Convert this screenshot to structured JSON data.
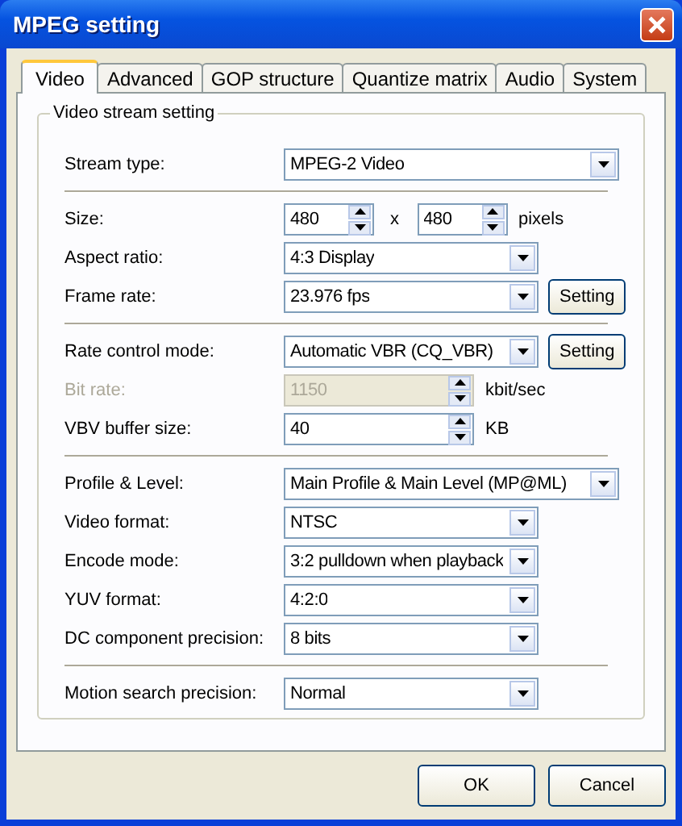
{
  "window": {
    "title": "MPEG setting"
  },
  "tabs": [
    {
      "label": "Video",
      "selected": true
    },
    {
      "label": "Advanced",
      "selected": false
    },
    {
      "label": "GOP structure",
      "selected": false
    },
    {
      "label": "Quantize matrix",
      "selected": false
    },
    {
      "label": "Audio",
      "selected": false
    },
    {
      "label": "System",
      "selected": false
    }
  ],
  "group": {
    "title": "Video stream setting",
    "sections": [
      [
        {
          "kind": "wide_combo",
          "label": "Stream type:",
          "value": "MPEG-2 Video"
        }
      ],
      [
        {
          "kind": "spin_pair",
          "label": "Size:",
          "values": [
            "480",
            "480"
          ],
          "separator": "x",
          "unit": "pixels"
        },
        {
          "kind": "combo",
          "label": "Aspect ratio:",
          "value": "4:3 Display"
        },
        {
          "kind": "combo",
          "label": "Frame rate:",
          "value": "23.976 fps",
          "button": "Setting"
        }
      ],
      [
        {
          "kind": "combo",
          "label": "Rate control mode:",
          "value": "Automatic VBR (CQ_VBR)",
          "button": "Setting"
        },
        {
          "kind": "spin",
          "label": "Bit rate:",
          "value": "1150",
          "unit": "kbit/sec",
          "disabled": true
        },
        {
          "kind": "spin",
          "label": "VBV buffer size:",
          "value": "40",
          "unit": "KB",
          "disabled": false
        }
      ],
      [
        {
          "kind": "wide_combo",
          "label": "Profile & Level:",
          "value": "Main Profile & Main Level (MP@ML)"
        },
        {
          "kind": "combo",
          "label": "Video format:",
          "value": "NTSC"
        },
        {
          "kind": "combo",
          "label": "Encode mode:",
          "value": "3:2 pulldown when playback"
        },
        {
          "kind": "combo",
          "label": "YUV format:",
          "value": "4:2:0"
        },
        {
          "kind": "combo",
          "label": "DC component precision:",
          "value": "8 bits"
        }
      ],
      [
        {
          "kind": "combo",
          "label": "Motion search precision:",
          "value": "Normal"
        }
      ]
    ]
  },
  "buttons": [
    {
      "label": "OK"
    },
    {
      "label": "Cancel"
    }
  ]
}
